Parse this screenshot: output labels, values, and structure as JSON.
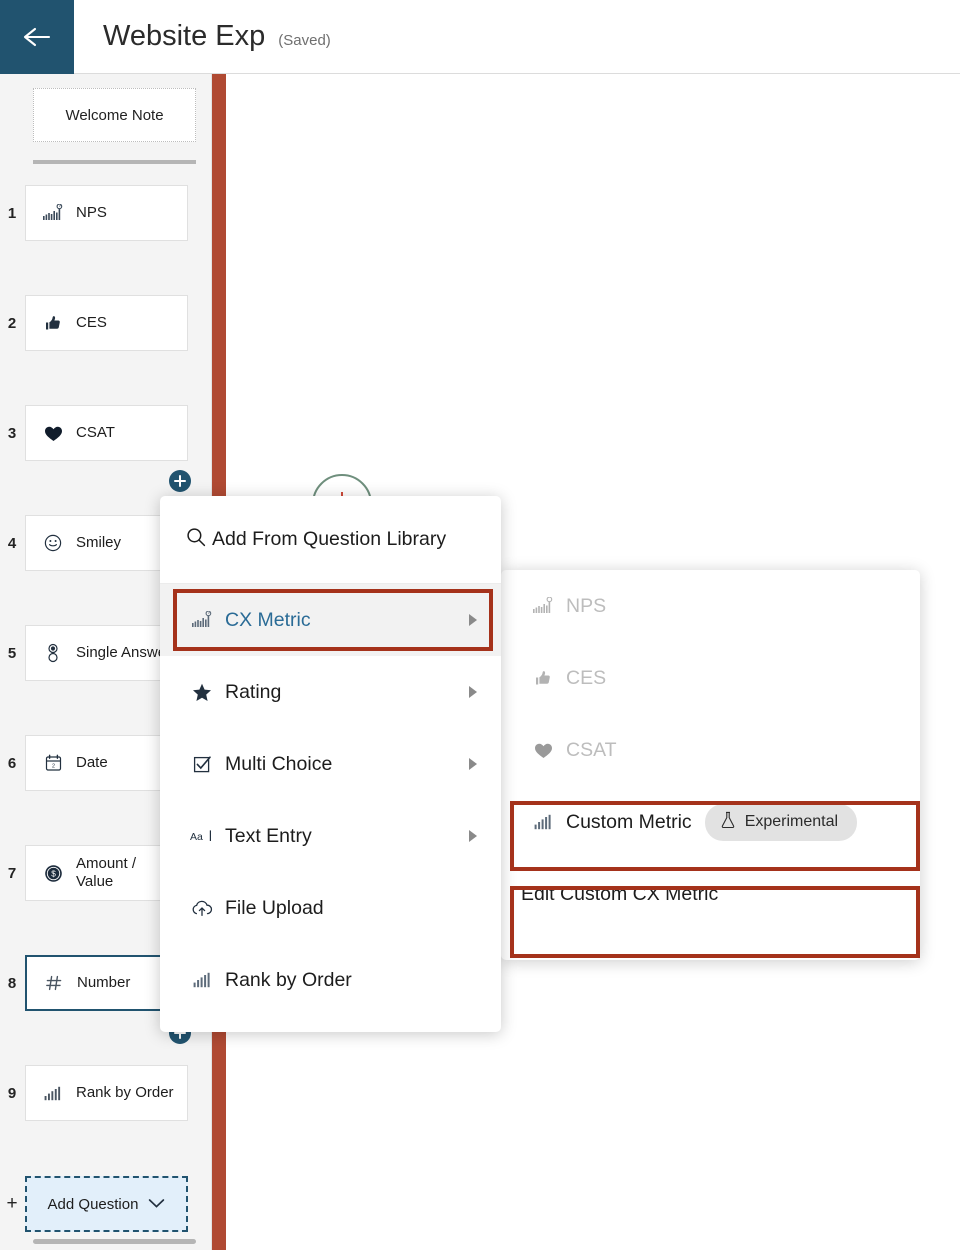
{
  "header": {
    "back_icon": "arrow-left-icon",
    "title": "Website Exp",
    "saved_label": "(Saved)"
  },
  "sidebar": {
    "welcome_note": "Welcome Note",
    "questions": [
      {
        "num": "1",
        "label": "NPS",
        "icon": "nps-gauge-bars-icon"
      },
      {
        "num": "2",
        "label": "CES",
        "icon": "thumbs-up-icon"
      },
      {
        "num": "3",
        "label": "CSAT",
        "icon": "heart-icon"
      },
      {
        "num": "4",
        "label": "Smiley",
        "icon": "smiley-face-icon"
      },
      {
        "num": "5",
        "label": "Single Answer",
        "icon": "radio-button-icon"
      },
      {
        "num": "6",
        "label": "Date",
        "icon": "calendar-icon"
      },
      {
        "num": "7",
        "label": "Amount / Value",
        "icon": "dollar-coin-icon"
      },
      {
        "num": "8",
        "label": "Number",
        "icon": "hash-icon"
      },
      {
        "num": "9",
        "label": "Rank by Order",
        "icon": "bar-rank-icon"
      }
    ],
    "add_question": {
      "plus": "+",
      "label": "Add Question",
      "chevron_icon": "chevron-down-icon"
    }
  },
  "menu": {
    "search_icon": "search-icon",
    "search_label": "Add From Question Library",
    "items": [
      {
        "label": "CX Metric",
        "icon": "nps-gauge-bars-icon",
        "arrow": true,
        "active": true
      },
      {
        "label": "Rating",
        "icon": "star-icon",
        "arrow": true,
        "active": false
      },
      {
        "label": "Multi Choice",
        "icon": "checkbox-icon",
        "arrow": true,
        "active": false
      },
      {
        "label": "Text Entry",
        "icon": "text-aa-icon",
        "arrow": true,
        "active": false
      },
      {
        "label": "File Upload",
        "icon": "cloud-upload-icon",
        "arrow": false,
        "active": false
      },
      {
        "label": "Rank by Order",
        "icon": "bar-rank-icon",
        "arrow": false,
        "active": false
      }
    ]
  },
  "submenu": {
    "items": [
      {
        "label": "NPS",
        "icon": "nps-gauge-bars-icon",
        "disabled": true
      },
      {
        "label": "CES",
        "icon": "thumbs-up-icon",
        "disabled": true
      },
      {
        "label": "CSAT",
        "icon": "heart-icon",
        "disabled": true
      }
    ],
    "custom_metric": {
      "label": "Custom Metric",
      "icon": "bar-rank-icon",
      "badge_icon": "flask-icon",
      "badge_label": "Experimental"
    },
    "edit_custom": {
      "label": "Edit Custom CX Metric"
    }
  },
  "colors": {
    "navy": "#21536F",
    "accent_bar": "#B04A33",
    "annotation": "#A5321B",
    "active_link": "#2a6b96",
    "add_question_bg": "#e2effa"
  }
}
